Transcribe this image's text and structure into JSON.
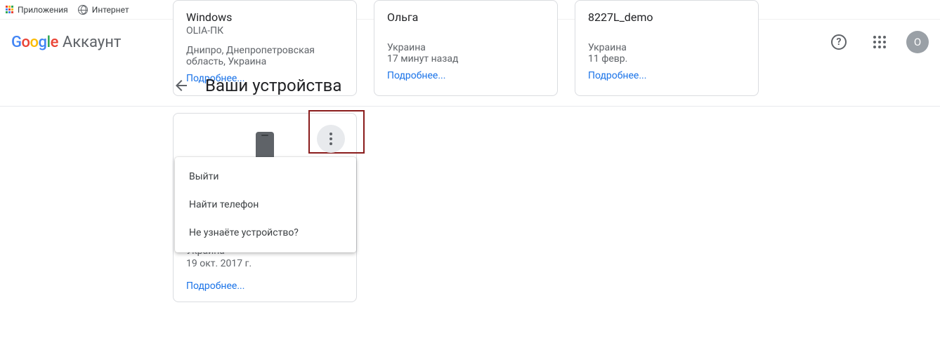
{
  "bookmarks": {
    "apps": "Приложения",
    "internet": "Интернет"
  },
  "brand_suffix": "Аккаунт",
  "avatar_letter": "O",
  "page_title": "Ваши устройства",
  "more_label": "Подробнее...",
  "cards_row1": [
    {
      "title": "Windows",
      "sub": "OLIA-ПК",
      "loc": "Днипро, Днепропетровская область, Украина"
    },
    {
      "title": "Ольга",
      "sub": "",
      "loc": "Украина",
      "date": "17 минут назад"
    },
    {
      "title": "8227L_demo",
      "sub": "",
      "loc": "Украина",
      "date": "11 февр."
    }
  ],
  "card2": {
    "loc": "Украина",
    "date": "19 окт. 2017 г."
  },
  "menu": {
    "signout": "Выйти",
    "find": "Найти телефон",
    "unknown": "Не узнаёте устройство?"
  }
}
